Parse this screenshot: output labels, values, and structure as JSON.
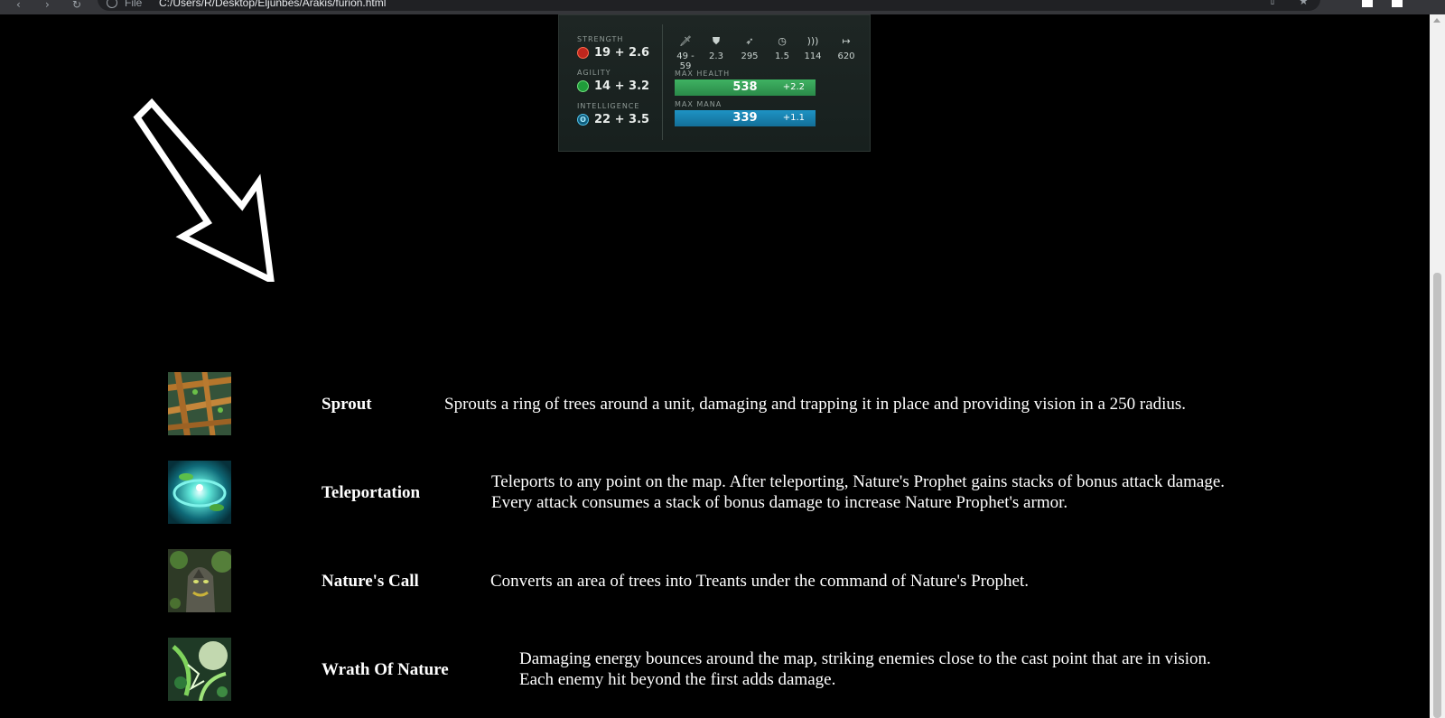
{
  "browser": {
    "protocol": "File",
    "url": "C:/Users/R/Desktop/Eljunbes/Arakis/furion.html",
    "nav_icons": [
      "back-icon",
      "forward-icon",
      "reload-icon"
    ]
  },
  "stats": {
    "strength": {
      "label": "STRENGTH",
      "value": "19 + 2.6"
    },
    "agility": {
      "label": "AGILITY",
      "value": "14 + 3.2"
    },
    "intelligence": {
      "label": "INTELLIGENCE",
      "value": "22 + 3.5"
    },
    "mini": [
      {
        "icon": "sword-icon",
        "value": "49 - 59"
      },
      {
        "icon": "shield-icon",
        "value": "2.3"
      },
      {
        "icon": "boot-icon",
        "value": "295"
      },
      {
        "icon": "clock-icon",
        "value": "1.5"
      },
      {
        "icon": "wave-icon",
        "value": "114"
      },
      {
        "icon": "range-icon",
        "value": "620"
      }
    ],
    "health": {
      "label": "MAX HEALTH",
      "value": "538",
      "regen": "+2.2",
      "fill": 1.0
    },
    "mana": {
      "label": "MAX MANA",
      "value": "339",
      "regen": "+1.1",
      "fill": 1.0
    }
  },
  "abilities": [
    {
      "name": "Sprout",
      "icon": "sprout-icon",
      "description": [
        "Sprouts a ring of trees around a unit, damaging and trapping it in place and providing vision in a 250 radius."
      ]
    },
    {
      "name": "Teleportation",
      "icon": "teleportation-icon",
      "description": [
        "Teleports to any point on the map. After teleporting, Nature's Prophet gains stacks of bonus attack damage.",
        "Every attack consumes a stack of bonus damage to increase Nature Prophet's armor."
      ]
    },
    {
      "name": "Nature's Call",
      "icon": "natures-call-icon",
      "description": [
        "Converts an area of trees into Treants under the command of Nature's Prophet."
      ]
    },
    {
      "name": "Wrath Of Nature",
      "icon": "wrath-of-nature-icon",
      "description": [
        "Damaging energy bounces around the map, striking enemies close to the cast point that are in vision.",
        "Each enemy hit beyond the first adds damage."
      ]
    }
  ],
  "colors": {
    "background": "#000000",
    "health": "#3fb262",
    "mana": "#1e93c4"
  }
}
